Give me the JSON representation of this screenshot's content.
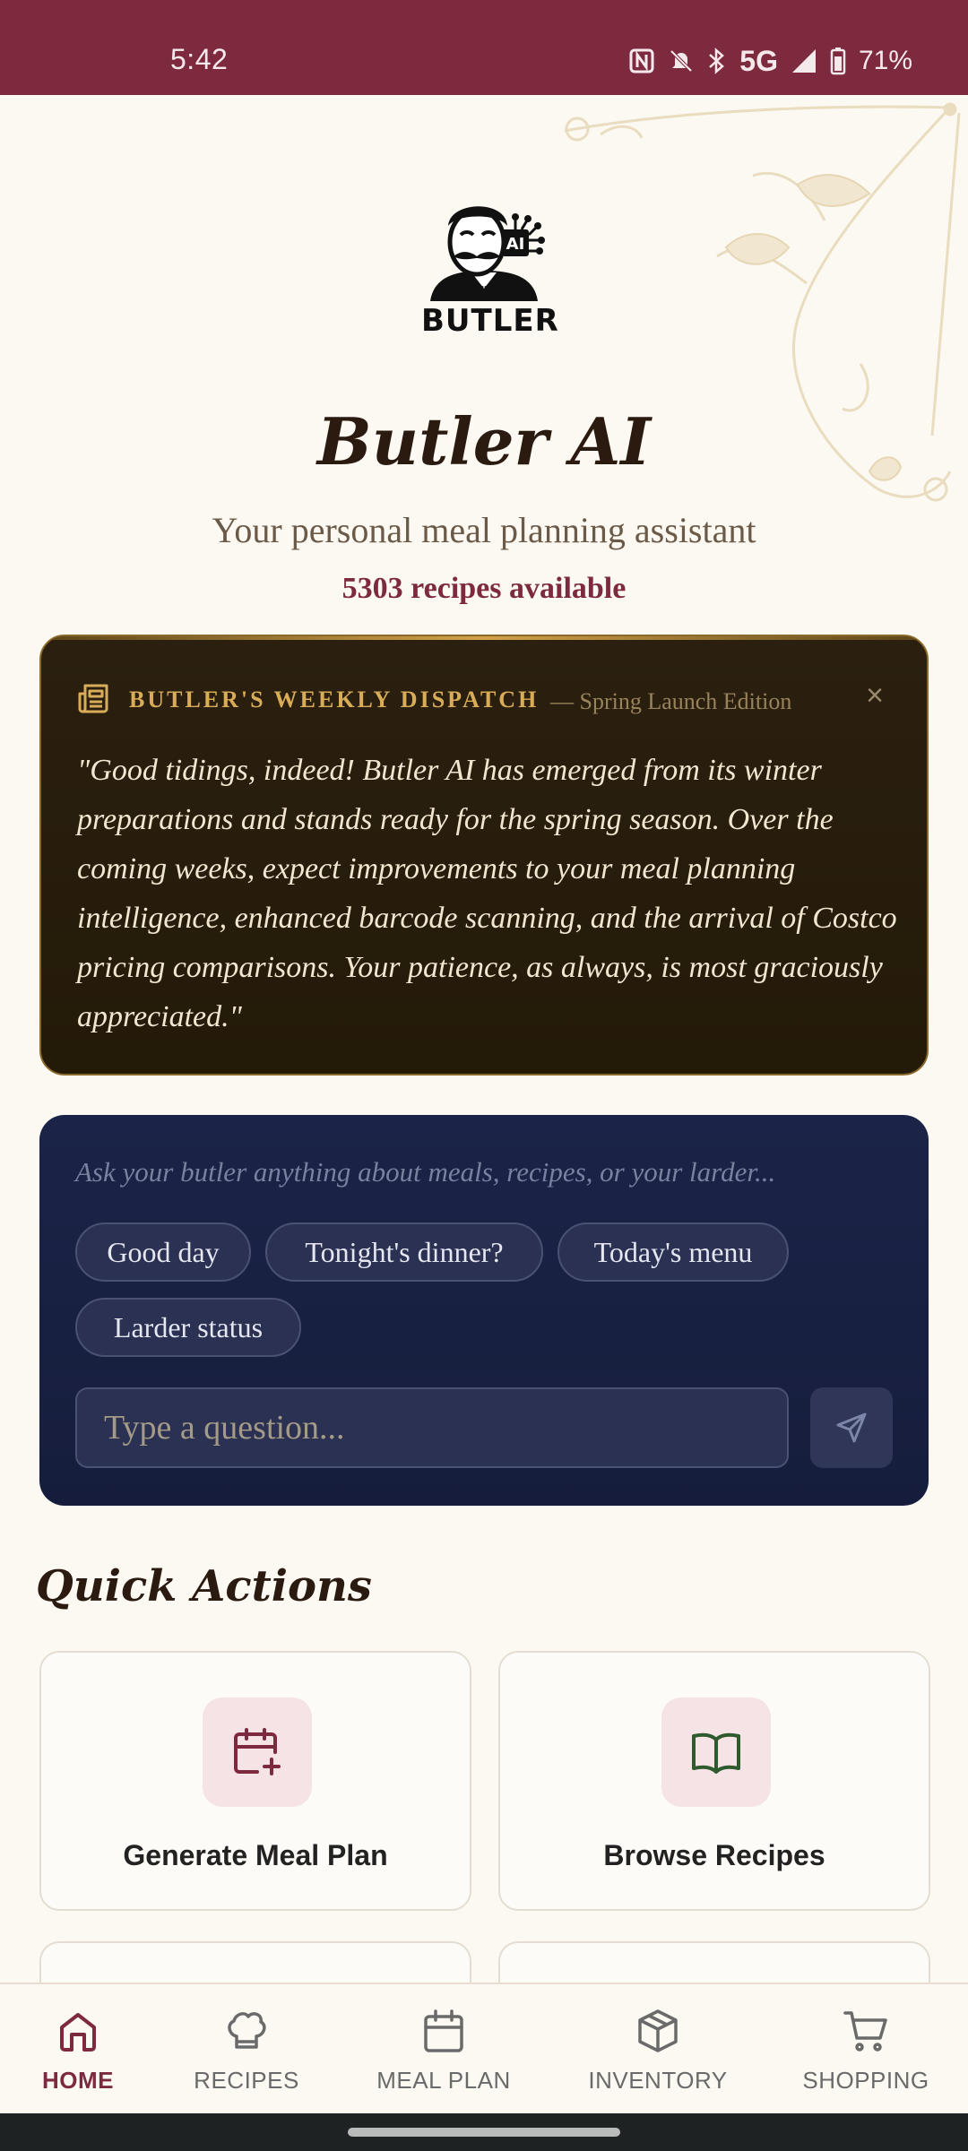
{
  "status_bar": {
    "time": "5:42",
    "network": "5G",
    "battery": "71%",
    "icons": [
      "nfc-icon",
      "mute-icon",
      "bluetooth-icon",
      "signal-icon",
      "battery-icon"
    ]
  },
  "hero": {
    "logo_text": "BUTLER",
    "logo_badge": "AI",
    "title": "Butler AI",
    "subtitle": "Your personal meal planning assistant",
    "recipe_count": "5303 recipes available"
  },
  "dispatch": {
    "heading": "BUTLER'S WEEKLY DISPATCH",
    "edition": "— Spring Launch Edition",
    "close": "×",
    "body": "\"Good tidings, indeed! Butler AI has emerged from its winter preparations and stands ready for the spring season. Over the coming weeks, expect improvements to your meal planning intelligence, enhanced barcode scanning, and the arrival of Costco pricing comparisons. Your patience, as always, is most graciously appreciated.\""
  },
  "chat": {
    "prompt": "Ask your butler anything about meals, recipes, or your larder...",
    "chips": [
      "Good day",
      "Tonight's dinner?",
      "Today's menu",
      "Larder status"
    ],
    "input_placeholder": "Type a question..."
  },
  "quick_actions": {
    "title": "Quick Actions",
    "items": [
      {
        "label": "Generate Meal Plan",
        "icon": "calendar-plus-icon"
      },
      {
        "label": "Browse Recipes",
        "icon": "open-book-icon"
      }
    ]
  },
  "bottom_nav": {
    "active": "HOME",
    "items": [
      {
        "label": "HOME",
        "icon": "home-icon"
      },
      {
        "label": "RECIPES",
        "icon": "chef-hat-icon"
      },
      {
        "label": "MEAL PLAN",
        "icon": "calendar-icon"
      },
      {
        "label": "INVENTORY",
        "icon": "box-icon"
      },
      {
        "label": "SHOPPING",
        "icon": "cart-icon"
      }
    ]
  },
  "colors": {
    "brand": "#7d2a3e",
    "background": "#fcf9f3",
    "dispatch_gold": "#d9ad58",
    "chat_navy": "#1b2448"
  }
}
